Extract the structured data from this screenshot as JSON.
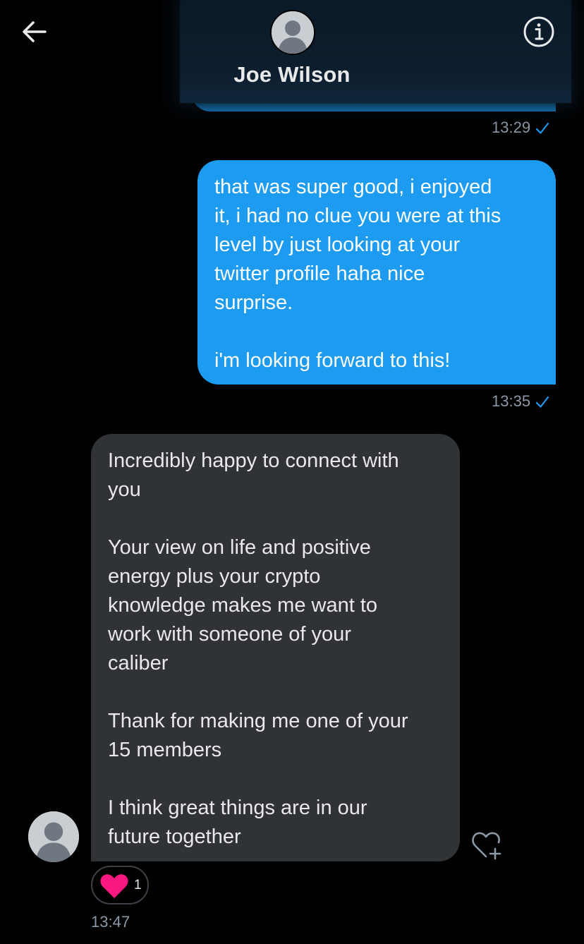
{
  "header": {
    "contact_name": "Joe Wilson",
    "back_icon": "arrow-left-icon",
    "info_icon": "info-circle-icon"
  },
  "messages": [
    {
      "direction": "outgoing",
      "time": "13:29",
      "status": "sent-check"
    },
    {
      "direction": "outgoing",
      "paragraphs": [
        "that was super good, i enjoyed\nit, i had no clue you were at this\nlevel by just looking at your\ntwitter profile haha nice\nsurprise.",
        "i'm looking forward to this!"
      ],
      "time": "13:35",
      "status": "sent-check"
    },
    {
      "direction": "incoming",
      "paragraphs": [
        "Incredibly happy to connect with\nyou",
        "Your view on life and positive\nenergy plus your crypto\nknowledge makes me want to\nwork with someone of your\ncaliber",
        "Thank for making me one of your\n15 members",
        "I think great things are in our\nfuture together"
      ],
      "reaction": {
        "icon": "heart-icon",
        "count": "1"
      },
      "time": "13:47"
    }
  ],
  "colors": {
    "outgoing_bubble": "#1d9bf0",
    "incoming_bubble": "#2f3336",
    "timestamp": "#8b98a5",
    "heart": "#f91880"
  }
}
